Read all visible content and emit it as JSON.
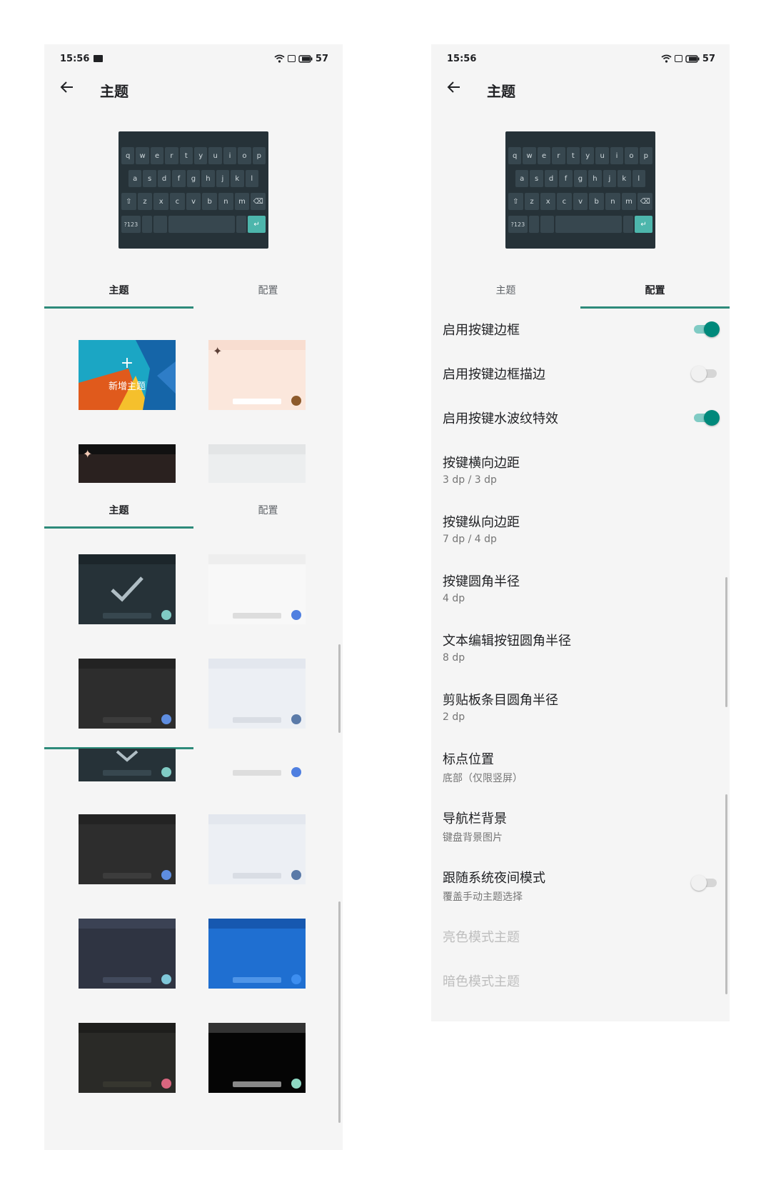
{
  "status": {
    "time": "15:56",
    "battery": "57"
  },
  "appbar": {
    "title": "主题"
  },
  "keyboard": {
    "row1": [
      "q",
      "w",
      "e",
      "r",
      "t",
      "y",
      "u",
      "i",
      "o",
      "p"
    ],
    "row2": [
      "a",
      "s",
      "d",
      "f",
      "g",
      "h",
      "j",
      "k",
      "l"
    ],
    "row3": [
      "⇧",
      "z",
      "x",
      "c",
      "v",
      "b",
      "n",
      "m",
      "⌫"
    ],
    "symbols_key": "?123",
    "enter_key": "↵"
  },
  "tabs": {
    "theme": "主题",
    "config": "配置"
  },
  "new_theme": {
    "plus": "+",
    "label": "新增主题"
  },
  "colors": {
    "accent": "#2e8b7a",
    "toggle_on": "#00897b"
  },
  "settings": [
    {
      "title": "启用按键边框",
      "toggle": "on"
    },
    {
      "title": "启用按键边框描边",
      "toggle": "off"
    },
    {
      "title": "启用按键水波纹特效",
      "toggle": "on"
    },
    {
      "title": "按键横向边距",
      "sub": "3 dp / 3 dp"
    },
    {
      "title": "按键纵向边距",
      "sub": "7 dp / 4 dp"
    },
    {
      "title": "按键圆角半径",
      "sub": "4 dp"
    },
    {
      "title": "文本编辑按钮圆角半径",
      "sub": "8 dp"
    },
    {
      "title": "剪贴板条目圆角半径",
      "sub": "2 dp"
    },
    {
      "title": "标点位置",
      "sub": "底部（仅限竖屏）"
    },
    {
      "title": "导航栏背景",
      "sub": "键盘背景图片"
    },
    {
      "title": "跟随系统夜间模式",
      "sub": "覆盖手动主题选择",
      "toggle": "off"
    },
    {
      "title": "亮色模式主题",
      "disabled": true
    },
    {
      "title": "暗色模式主题",
      "disabled": true
    }
  ]
}
